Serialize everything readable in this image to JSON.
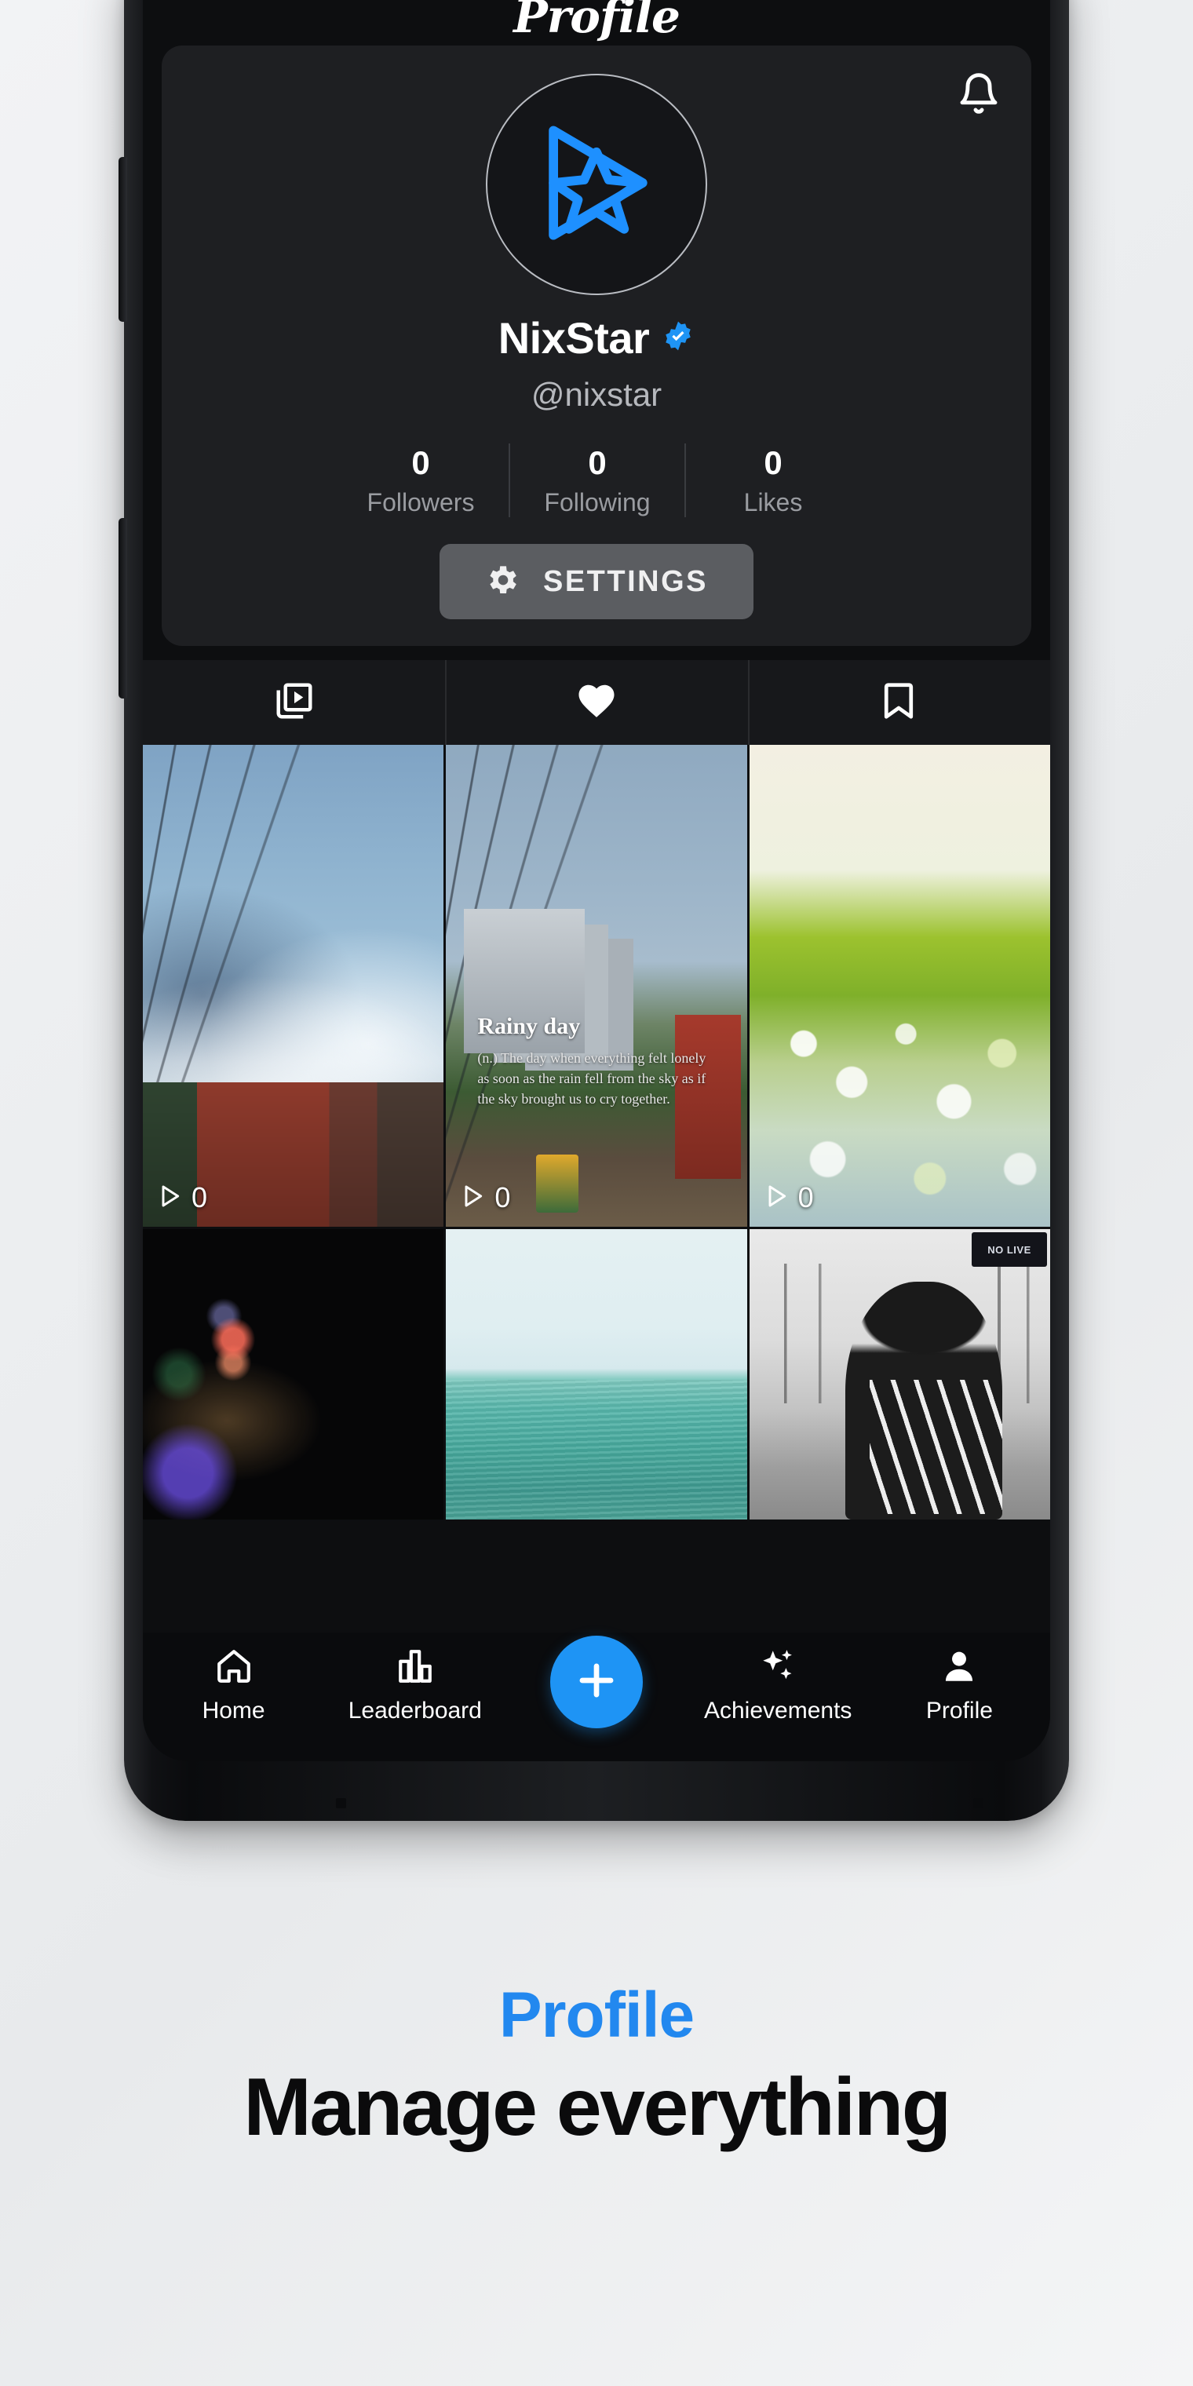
{
  "app": {
    "header_title": "Profile"
  },
  "profile": {
    "notification_icon": "bell-icon",
    "avatar_icon": "play-star-logo",
    "display_name": "NixStar",
    "verified_icon": "verified-badge-icon",
    "username": "@nixstar",
    "stats": [
      {
        "value": "0",
        "label": "Followers"
      },
      {
        "value": "0",
        "label": "Following"
      },
      {
        "value": "0",
        "label": "Likes"
      }
    ],
    "settings_button": {
      "icon": "gear-icon",
      "label": "SETTINGS"
    }
  },
  "content_tabs": [
    {
      "name": "videos",
      "icon": "video-reels-icon",
      "active": true
    },
    {
      "name": "liked",
      "icon": "heart-icon",
      "active": false
    },
    {
      "name": "saved",
      "icon": "bookmark-icon",
      "active": false
    }
  ],
  "video_grid": [
    {
      "id": "tile-1",
      "art": "t-sky",
      "play_icon": "play-icon",
      "play_count": "0",
      "caption_title": "",
      "caption_body": ""
    },
    {
      "id": "tile-2",
      "art": "t-city",
      "play_icon": "play-icon",
      "play_count": "0",
      "caption_title": "Rainy day",
      "caption_body": "(n.) The day when everything felt lonely as soon as the rain fell from the sky as if the sky brought us to cry together."
    },
    {
      "id": "tile-3",
      "art": "t-bokeh",
      "play_icon": "play-icon",
      "play_count": "0",
      "caption_title": "",
      "caption_body": ""
    },
    {
      "id": "tile-4",
      "art": "t-dark-neon",
      "play_icon": "play-icon",
      "play_count": "",
      "caption_title": "",
      "caption_body": ""
    },
    {
      "id": "tile-5",
      "art": "t-sea",
      "play_icon": "play-icon",
      "play_count": "",
      "caption_title": "",
      "caption_body": ""
    },
    {
      "id": "tile-6",
      "art": "t-bw",
      "play_icon": "play-icon",
      "play_count": "",
      "caption_title": "",
      "caption_body": "",
      "badge_text": "NO LIVE"
    }
  ],
  "bottom_nav": {
    "items": [
      {
        "icon": "home-icon",
        "label": "Home",
        "active": false
      },
      {
        "icon": "bar-chart-icon",
        "label": "Leaderboard",
        "active": false
      },
      {
        "icon": "sparkles-icon",
        "label": "Achievements",
        "active": false
      },
      {
        "icon": "person-icon",
        "label": "Profile",
        "active": true
      }
    ],
    "create_button": {
      "icon": "plus-icon",
      "label": ""
    }
  },
  "caption": {
    "eyebrow": "Profile",
    "headline": "Manage everything"
  },
  "colors": {
    "accent": "#1e94f5",
    "caption_blue": "#2288ef",
    "card_bg": "#1e1f22",
    "screen_bg": "#0d0e10"
  }
}
